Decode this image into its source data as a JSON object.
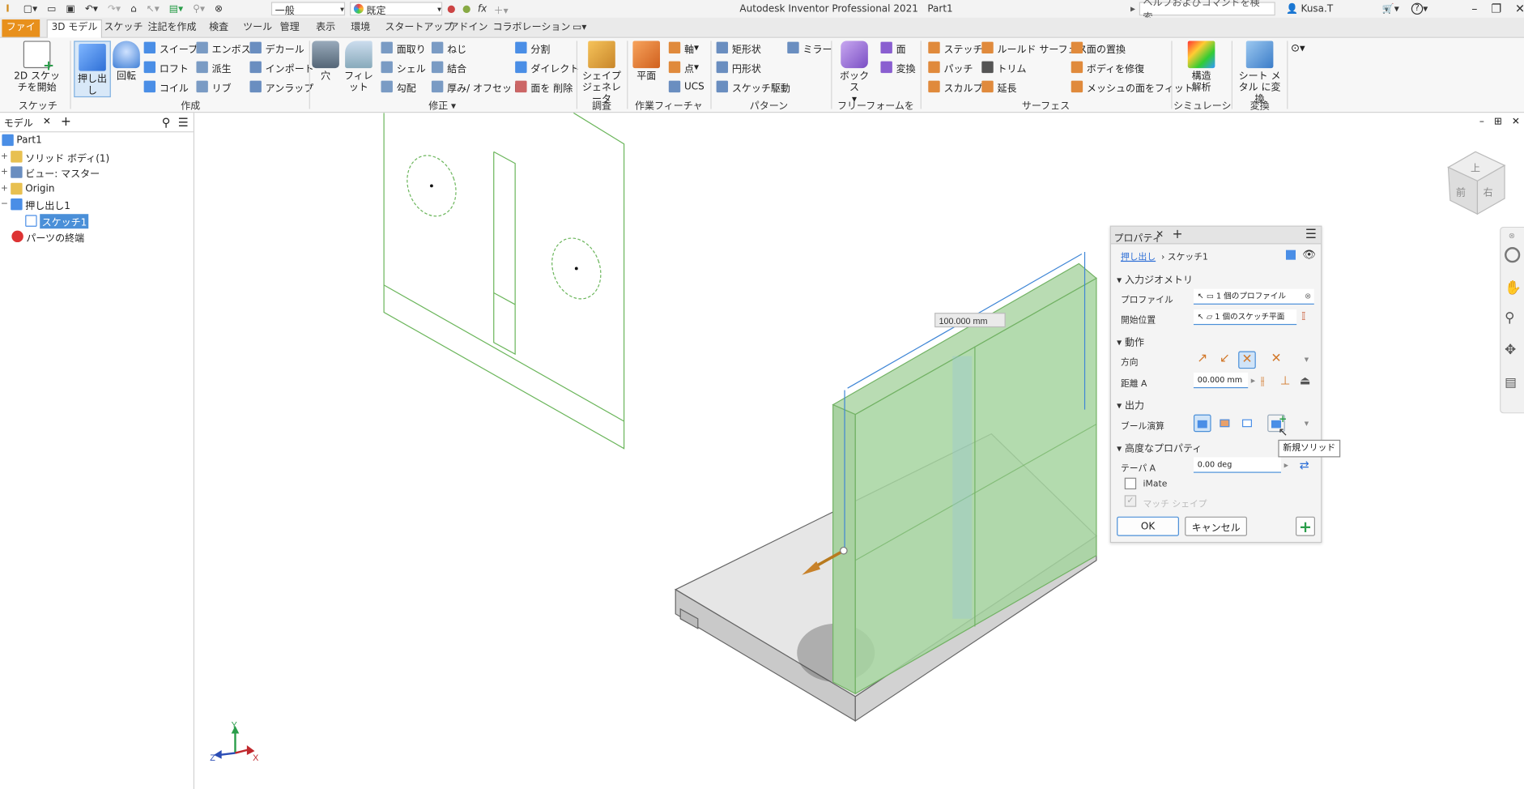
{
  "title_bar": {
    "app_title": "Autodesk Inventor Professional 2021",
    "doc_name": "Part1",
    "material": "一般",
    "appearance": "既定",
    "search_placeholder": "ヘルプおよびコマンドを検索...",
    "user": "Kusa.T",
    "help": "?"
  },
  "tabs": [
    "ファイル",
    "3D モデル",
    "スケッチ",
    "注記を作成",
    "検査",
    "ツール",
    "管理",
    "表示",
    "環境",
    "スタートアップ",
    "アドイン",
    "コラボレーション"
  ],
  "ribbon": {
    "sketch_group": {
      "start_2d_sketch": "2D スケッチを開始",
      "label": "スケッチ"
    },
    "create_group": {
      "extrude": "押し出し",
      "revolve": "回転",
      "sweep": "スイープ",
      "loft": "ロフト",
      "coil": "コイル",
      "emboss": "エンボス",
      "derive": "派生",
      "rib": "リブ",
      "decal": "デカール",
      "import": "インポート",
      "unwrap": "アンラップ",
      "label": "作成"
    },
    "modify_group": {
      "hole": "穴",
      "fillet": "フィレット",
      "chamfer": "面取り",
      "shell": "シェル",
      "draft": "勾配",
      "thread": "ねじ",
      "combine": "結合",
      "thicken": "厚み/ オフセット",
      "split": "分割",
      "direct": "ダイレクト",
      "delete_face": "面を 削除",
      "label": "修正 ▾"
    },
    "explore_group": {
      "shape_generator": "シェイプ ジェネレータ",
      "label": "調査"
    },
    "work_features": {
      "plane": "平面",
      "axis": "軸",
      "point": "点",
      "ucs": "UCS",
      "label": "作業フィーチャ"
    },
    "pattern_group": {
      "rectangular": "矩形状",
      "circular": "円形状",
      "sketch_driven": "スケッチ駆動",
      "mirror": "ミラー",
      "label": "パターン"
    },
    "freeform_group": {
      "box": "ボックス",
      "face": "面",
      "convert": "変換",
      "label": "フリーフォームを作成"
    },
    "surface_group": {
      "stitch": "ステッチ",
      "patch": "パッチ",
      "sculpt": "スカルプ",
      "ruled_surface": "ルールド サーフェス",
      "trim": "トリム",
      "extend": "延長",
      "replace_face": "面の置換",
      "repair_bodies": "ボディを修復",
      "fit_mesh_face": "メッシュの面をフィット",
      "label": "サーフェス"
    },
    "simulation_group": {
      "stress_analysis": "構造 解析",
      "label": "シミュレーション"
    },
    "convert_group": {
      "convert_sheet_metal": "シート メタル に変換",
      "label": "変換"
    }
  },
  "browser": {
    "tab": "モデル",
    "items": [
      {
        "label": "Part1",
        "expander": ""
      },
      {
        "label": "ソリッド ボディ(1)",
        "expander": "+"
      },
      {
        "label": "ビュー: マスター",
        "expander": "+"
      },
      {
        "label": "Origin",
        "expander": "+"
      },
      {
        "label": "押し出し1",
        "expander": "−"
      },
      {
        "label": "スケッチ1",
        "expander": ""
      },
      {
        "label": "パーツの終端",
        "expander": ""
      }
    ]
  },
  "viewport": {
    "dimension": "100.000 mm",
    "viewcube": {
      "top": "上",
      "front": "前",
      "right": "右"
    },
    "axes": {
      "x": "X",
      "y": "Y",
      "z": "Z"
    }
  },
  "properties": {
    "title": "プロパティ",
    "breadcrumb_link": "押し出し",
    "breadcrumb_current": "スケッチ1",
    "input_geometry": "入力ジオメトリ",
    "profile_label": "プロファイル",
    "profile_value": "1 個のプロファイル",
    "start_label": "開始位置",
    "start_value": "1 個のスケッチ平面",
    "behavior": "動作",
    "direction_label": "方向",
    "distance_label": "距離 A",
    "distance_value": "00.000 mm",
    "output": "出力",
    "boolean_label": "ブール演算",
    "advanced": "高度なプロパティ",
    "taper_label": "テーパ A",
    "taper_value": "0.00 deg",
    "imate": "iMate",
    "match_shape": "マッチ シェイプ",
    "ok": "OK",
    "cancel": "キャンセル",
    "tooltip": "新規ソリッド"
  },
  "colors": {
    "accent": "#4a8fd8",
    "file_tab": "#e8901c",
    "preview_green": "#9fd19a",
    "sketch_green": "#62b44d",
    "dim_blue": "#3f86d6"
  }
}
